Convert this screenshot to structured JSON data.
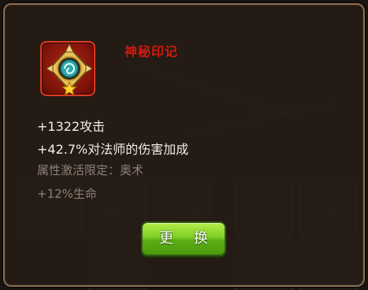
{
  "item": {
    "name": "神秘印记",
    "icon": "star-emblem-icon",
    "stats": [
      "+1322攻击",
      "+42.7%对法师的伤害加成",
      "属性激活限定：奥术",
      "+12%生命"
    ]
  },
  "actions": {
    "change_label": "更 换"
  },
  "background": {
    "ghost_numbers": [
      "17358",
      "17403",
      "17596",
      "17627",
      "17301"
    ]
  },
  "colors": {
    "name": "#d11a10",
    "button": "#7fcf24",
    "panel_border": "#8a6f55"
  }
}
